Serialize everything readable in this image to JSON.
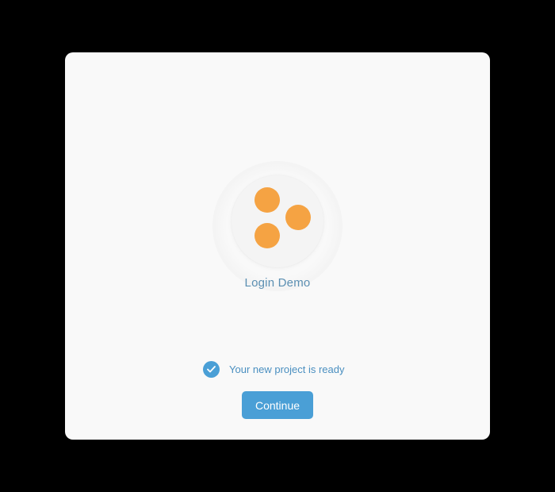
{
  "app": {
    "name": "Login Demo",
    "logo_icon": "three-dots-logo-icon"
  },
  "status": {
    "icon": "check-circle-icon",
    "text": "Your new project is ready"
  },
  "actions": {
    "continue_label": "Continue"
  },
  "colors": {
    "accent": "#4a9fd6",
    "logo_dots": "#f5a343",
    "app_name": "#5b8fb2",
    "status_text": "#4a8fc0",
    "dialog_background": "#f9f9f9",
    "backdrop": "#000000"
  }
}
